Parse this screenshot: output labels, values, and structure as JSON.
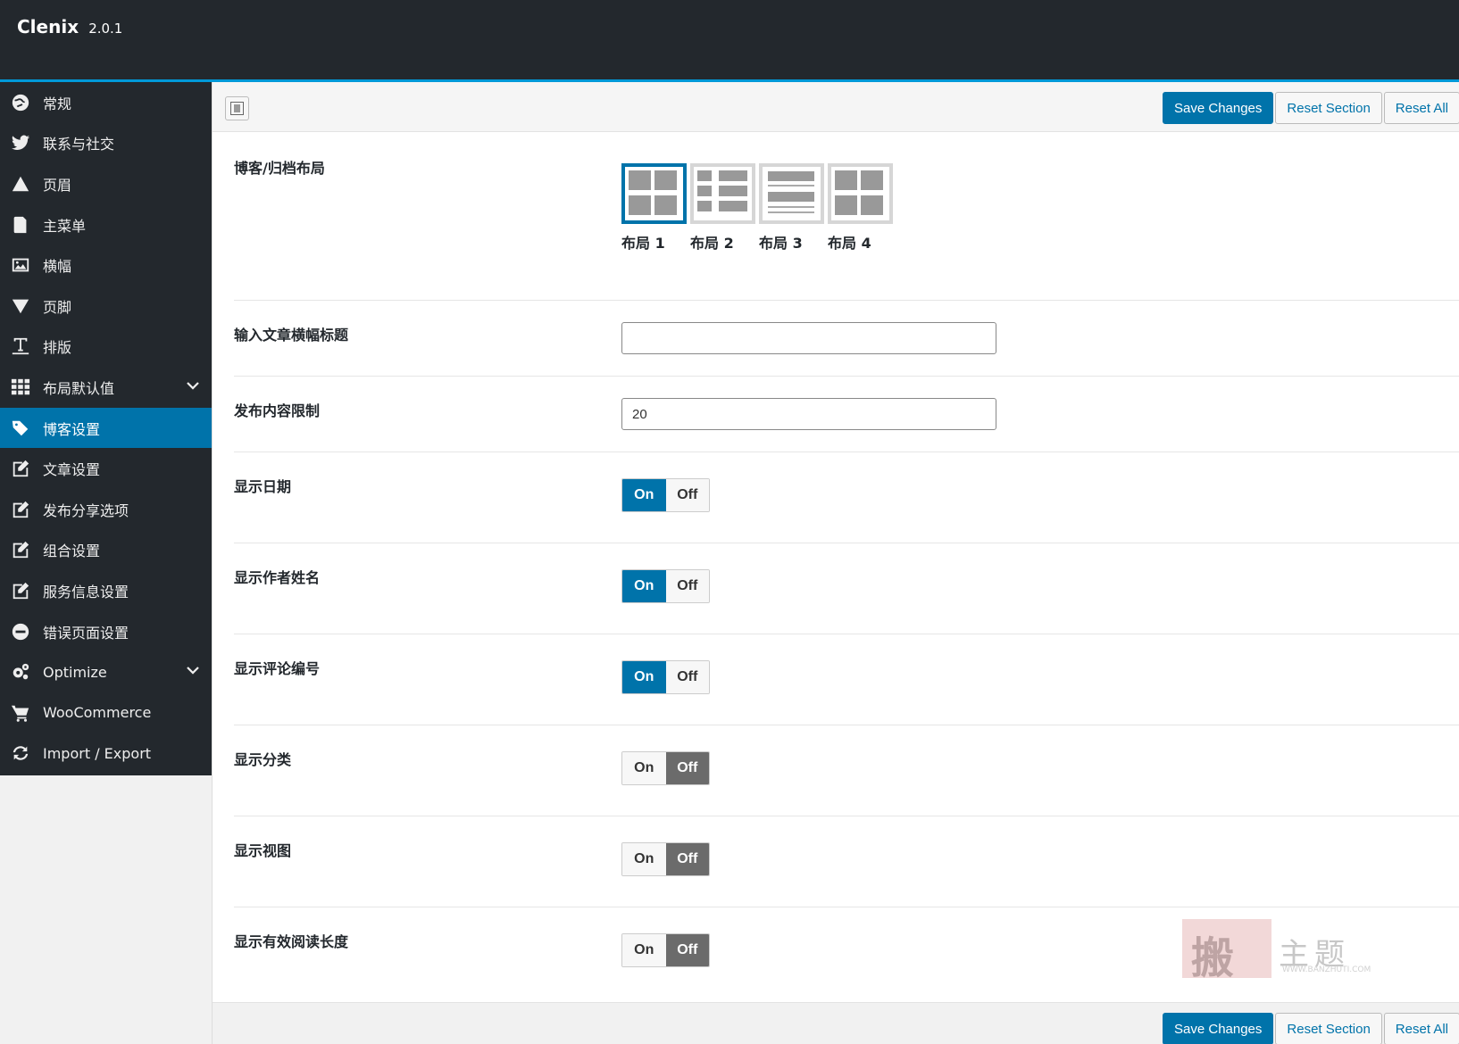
{
  "app": {
    "name": "Clenix",
    "version": "2.0.1"
  },
  "sidebar": {
    "items": [
      {
        "label": "常规",
        "icon": "globe-icon"
      },
      {
        "label": "联系与社交",
        "icon": "twitter-icon"
      },
      {
        "label": "页眉",
        "icon": "triangle-up-icon"
      },
      {
        "label": "主菜单",
        "icon": "book-icon"
      },
      {
        "label": "横幅",
        "icon": "image-icon"
      },
      {
        "label": "页脚",
        "icon": "triangle-down-icon"
      },
      {
        "label": "排版",
        "icon": "text-cursor-icon"
      },
      {
        "label": "布局默认值",
        "icon": "grid-icon",
        "expandable": true
      },
      {
        "label": "博客设置",
        "icon": "tags-icon",
        "active": true
      },
      {
        "label": "文章设置",
        "icon": "edit-icon"
      },
      {
        "label": "发布分享选项",
        "icon": "edit-icon"
      },
      {
        "label": "组合设置",
        "icon": "edit-icon"
      },
      {
        "label": "服务信息设置",
        "icon": "edit-icon"
      },
      {
        "label": "错误页面设置",
        "icon": "minus-circle-icon"
      },
      {
        "label": "Optimize",
        "icon": "gears-icon",
        "expandable": true
      },
      {
        "label": "WooCommerce",
        "icon": "cart-icon"
      },
      {
        "label": "Import / Export",
        "icon": "refresh-icon"
      }
    ]
  },
  "toolbar": {
    "save_label": "Save Changes",
    "reset_section_label": "Reset Section",
    "reset_all_label": "Reset All"
  },
  "fields": {
    "blog_layout": {
      "label": "博客/归档布局",
      "options": [
        "布局 1",
        "布局 2",
        "布局 3",
        "布局 4"
      ],
      "selected": "布局 1"
    },
    "banner_title": {
      "label": "输入文章横幅标题",
      "value": ""
    },
    "excerpt_limit": {
      "label": "发布内容限制",
      "value": "20"
    },
    "switch_on_label": "On",
    "switch_off_label": "Off",
    "toggles": [
      {
        "label": "显示日期",
        "state": "on"
      },
      {
        "label": "显示作者姓名",
        "state": "on"
      },
      {
        "label": "显示评论编号",
        "state": "on"
      },
      {
        "label": "显示分类",
        "state": "off"
      },
      {
        "label": "显示视图",
        "state": "off"
      },
      {
        "label": "显示有效阅读长度",
        "state": "off"
      }
    ]
  },
  "watermark": {
    "text": "搬主题",
    "url_text": "WWW.BANZHUTI.COM"
  },
  "colors": {
    "accent": "#0073aa",
    "header_bg": "#23282d",
    "header_border": "#0099d8",
    "off_bg": "#6b6b6b"
  }
}
